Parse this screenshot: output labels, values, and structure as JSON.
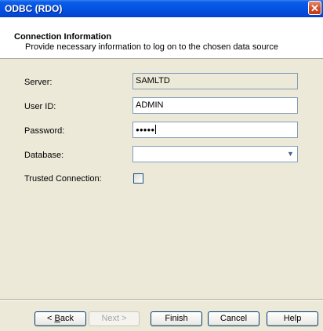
{
  "window": {
    "title": "ODBC (RDO)",
    "close_glyph": "✕"
  },
  "header": {
    "title": "Connection Information",
    "subtitle": "Provide necessary information to log on to the chosen data source"
  },
  "form": {
    "server": {
      "label": "Server:",
      "value": "SAMLTD",
      "readonly": true
    },
    "user_id": {
      "label": "User ID:",
      "value": "ADMIN"
    },
    "password": {
      "label": "Password:",
      "value": "●●●●●"
    },
    "database": {
      "label": "Database:",
      "value": "",
      "arrow": "▼"
    },
    "trusted_connection": {
      "label": "Trusted Connection:",
      "checked": false
    }
  },
  "buttons": {
    "back": {
      "prefix": "< ",
      "mnemonic": "B",
      "rest": "ack",
      "enabled": true
    },
    "next": {
      "label": "Next >",
      "enabled": false
    },
    "finish": {
      "label": "Finish"
    },
    "cancel": {
      "label": "Cancel"
    },
    "help": {
      "label": "Help"
    }
  }
}
